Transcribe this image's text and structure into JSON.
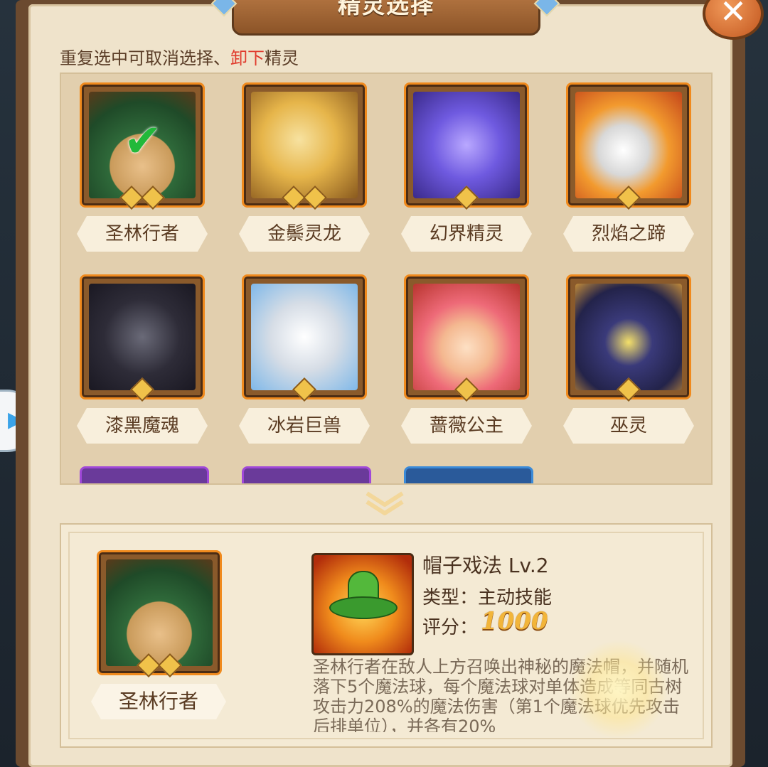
{
  "window": {
    "title": "精灵选择",
    "close_label": "✕",
    "side_tab_glyph": "▶"
  },
  "hint": {
    "prefix": "重复选中可取消选择、",
    "highlight": "卸下",
    "suffix": "精灵"
  },
  "colors": {
    "card_border": "#f08a1d",
    "highlight_text": "#e03a2c",
    "check": "#22b93a",
    "score": "#f2b53a"
  },
  "spirits": [
    {
      "name": "圣林行者",
      "stars": 2,
      "selected": true,
      "art": "green-hat-cat"
    },
    {
      "name": "金鬃灵龙",
      "stars": 2,
      "selected": false,
      "art": "golden-dragon"
    },
    {
      "name": "幻界精灵",
      "stars": 1,
      "selected": false,
      "art": "blue-spirit"
    },
    {
      "name": "烈焰之蹄",
      "stars": 1,
      "selected": false,
      "art": "flame-helm"
    },
    {
      "name": "漆黑魔魂",
      "stars": 1,
      "selected": false,
      "art": "dark-beast"
    },
    {
      "name": "冰岩巨兽",
      "stars": 1,
      "selected": false,
      "art": "ice-yeti"
    },
    {
      "name": "蔷薇公主",
      "stars": 1,
      "selected": false,
      "art": "rose-princess"
    },
    {
      "name": "巫灵",
      "stars": 1,
      "selected": false,
      "art": "witch-hat"
    }
  ],
  "detail": {
    "spirit_name": "圣林行者",
    "stars": 2,
    "skill_name": "帽子戏法 Lv.2",
    "type_line": "类型：主动技能",
    "score_label": "评分：",
    "score_value": "1000",
    "description": "圣林行者在敌人上方召唤出神秘的魔法帽，并随机落下5个魔法球，每个魔法球对单体造成等同古树攻击力208%的魔法伤害（第1个魔法球优先攻击后排单位），并各有20%"
  }
}
